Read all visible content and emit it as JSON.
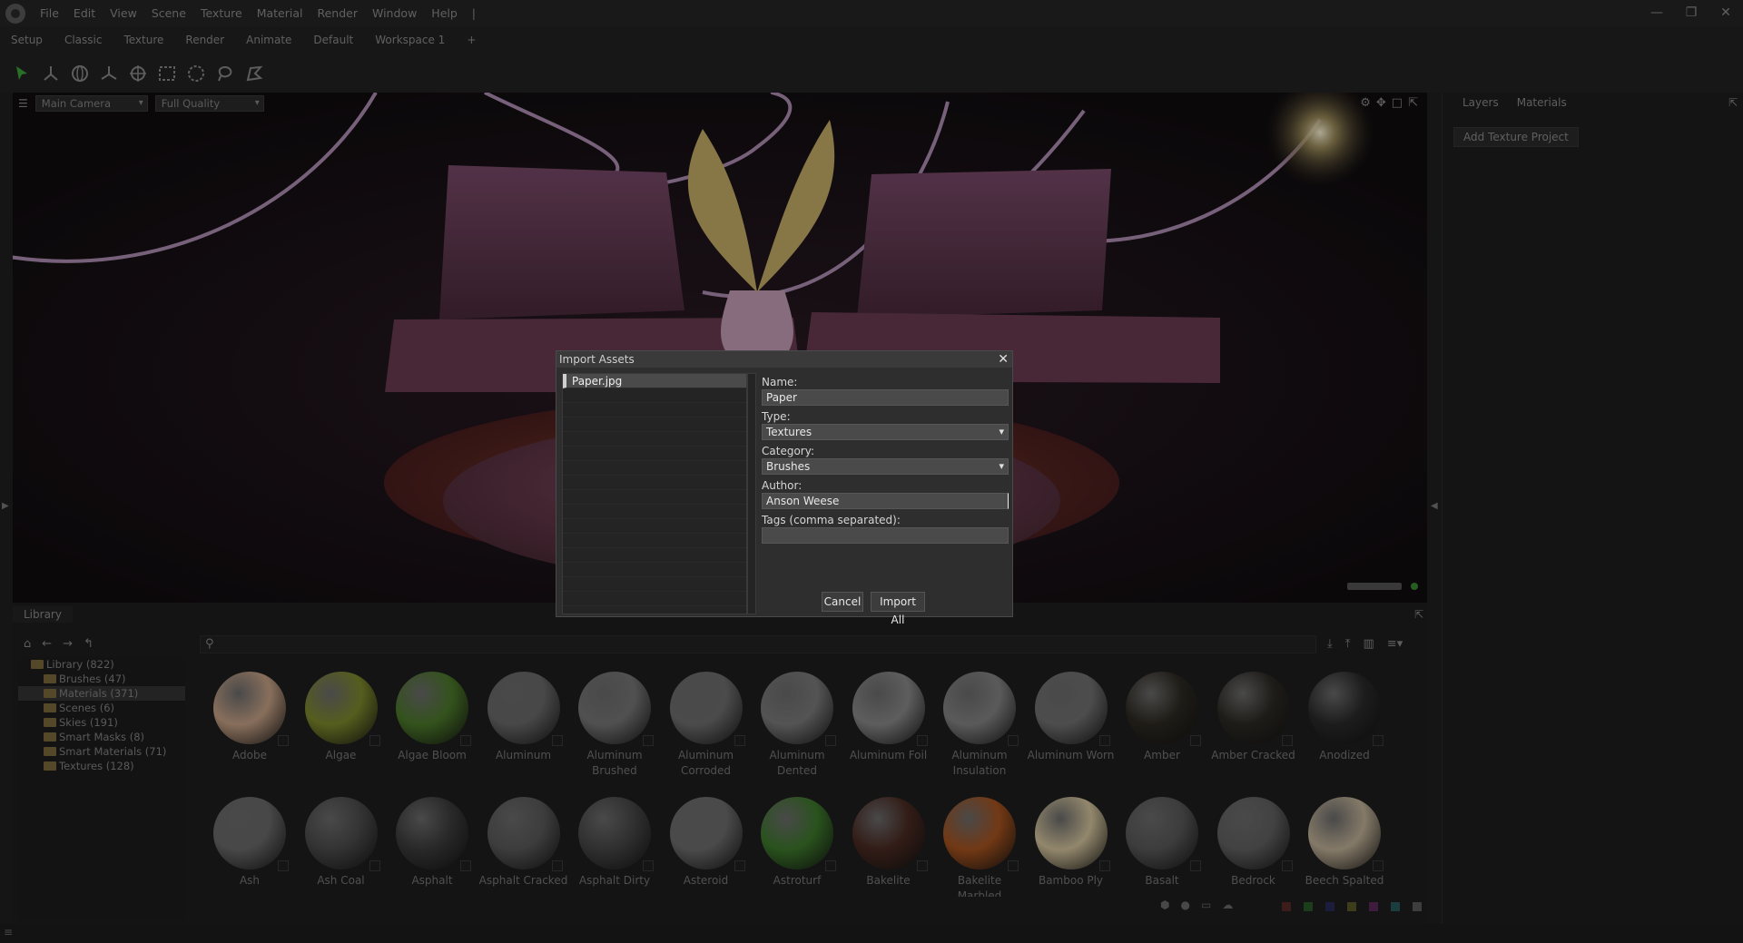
{
  "menu": [
    "File",
    "Edit",
    "View",
    "Scene",
    "Texture",
    "Material",
    "Render",
    "Window",
    "Help",
    "|"
  ],
  "window_controls": [
    "—",
    "❐",
    "✕"
  ],
  "workspaces": [
    "Setup",
    "Classic",
    "Texture",
    "Render",
    "Animate",
    "Default",
    "Workspace 1",
    "+"
  ],
  "viewport": {
    "camera": "Main Camera",
    "quality": "Full Quality"
  },
  "right_panel": {
    "tabs": [
      "Layers",
      "Materials"
    ],
    "add_button": "Add Texture Project"
  },
  "library": {
    "tab": "Library",
    "tree": [
      {
        "label": "Library (822)",
        "root": true
      },
      {
        "label": "Brushes (47)"
      },
      {
        "label": "Materials (371)",
        "selected": true
      },
      {
        "label": "Scenes (6)"
      },
      {
        "label": "Skies (191)"
      },
      {
        "label": "Smart Masks (8)"
      },
      {
        "label": "Smart Materials (71)"
      },
      {
        "label": "Textures (128)"
      }
    ],
    "materials_row1": [
      {
        "name": "Adobe",
        "color": "#c9a488"
      },
      {
        "name": "Algae",
        "color": "#7f8a2c"
      },
      {
        "name": "Algae Bloom",
        "color": "#4c7a2a"
      },
      {
        "name": "Aluminum",
        "color": "#6a6a6a"
      },
      {
        "name": "Aluminum Brushed",
        "color": "#777777"
      },
      {
        "name": "Aluminum Corroded",
        "color": "#6f6f6f"
      },
      {
        "name": "Aluminum Dented",
        "color": "#7c7c7c"
      },
      {
        "name": "Aluminum Foil",
        "color": "#8a8a8a"
      },
      {
        "name": "Aluminum Insulation",
        "color": "#858585"
      },
      {
        "name": "Aluminum Worn",
        "color": "#727272"
      },
      {
        "name": "Amber",
        "color": "#2e2a22"
      },
      {
        "name": "Amber Cracked",
        "color": "#2d2a24"
      },
      {
        "name": "Anodized",
        "color": "#2a2a2a"
      }
    ],
    "materials_row2": [
      {
        "name": "Ash",
        "color": "#6a6a6a"
      },
      {
        "name": "Ash Coal",
        "color": "#4c4c4c"
      },
      {
        "name": "Asphalt",
        "color": "#3c3c3c"
      },
      {
        "name": "Asphalt Cracked",
        "color": "#5a5a5a"
      },
      {
        "name": "Asphalt Dirty",
        "color": "#474747"
      },
      {
        "name": "Asteroid",
        "color": "#6e6e6e"
      },
      {
        "name": "Astroturf",
        "color": "#3e7a2c"
      },
      {
        "name": "Bakelite",
        "color": "#4a2a22"
      },
      {
        "name": "Bakelite Marbled",
        "color": "#a8541f"
      },
      {
        "name": "Bamboo Ply",
        "color": "#d8c8a0"
      },
      {
        "name": "Basalt",
        "color": "#5a5a5a"
      },
      {
        "name": "Bedrock",
        "color": "#626262"
      },
      {
        "name": "Beech Spalted",
        "color": "#c4b49a"
      }
    ]
  },
  "dialog": {
    "title": "Import Assets",
    "close": "✕",
    "files": [
      "Paper.jpg"
    ],
    "name_label": "Name:",
    "name_value": "Paper",
    "type_label": "Type:",
    "type_value": "Textures",
    "category_label": "Category:",
    "category_value": "Brushes",
    "author_label": "Author:",
    "author_value": "Anson Weese",
    "tags_label": "Tags (comma separated):",
    "tags_value": "",
    "cancel": "Cancel",
    "import_all": "Import All"
  },
  "swatches": [
    "#5a2a2a",
    "#2a5a2a",
    "#2a2a5a",
    "#5a5a2a",
    "#5a2a5a",
    "#2a5a5a",
    "#5a5a5a"
  ]
}
